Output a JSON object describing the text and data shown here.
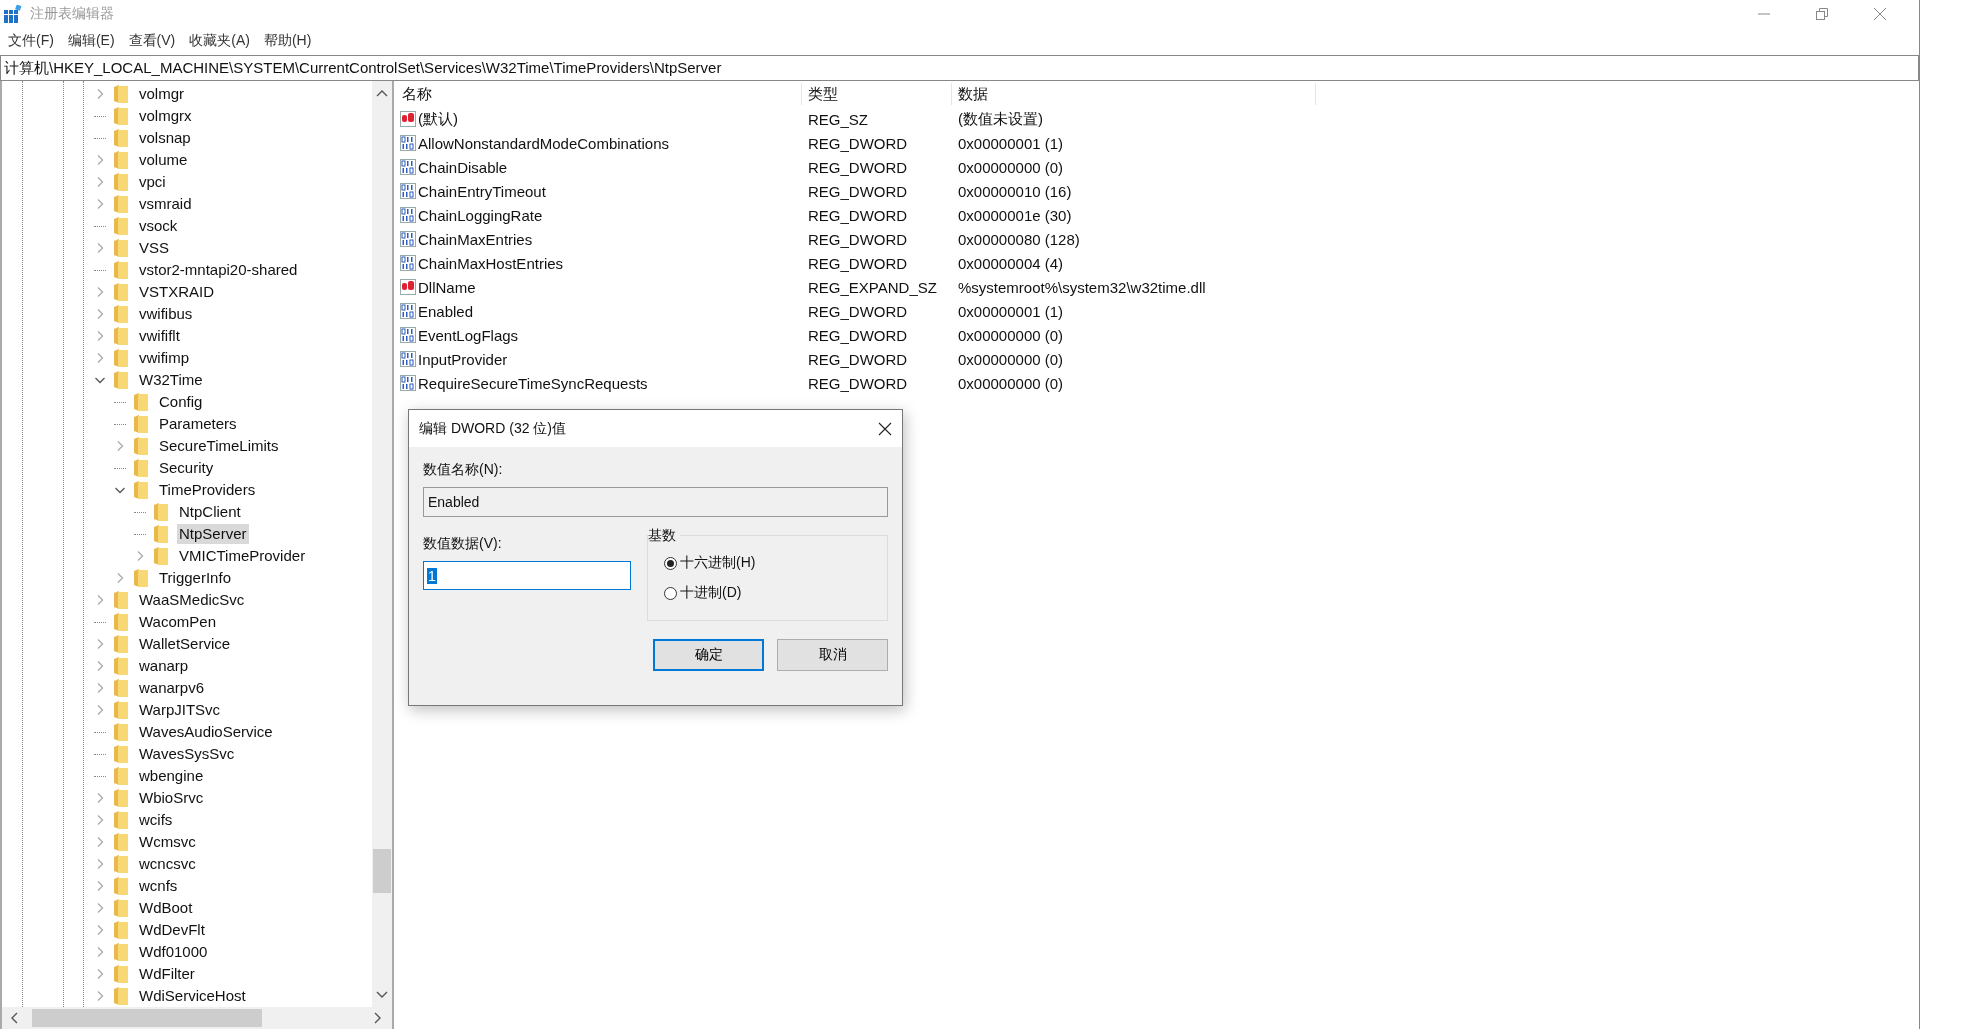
{
  "window": {
    "title": "注册表编辑器"
  },
  "menu": [
    "文件(F)",
    "编辑(E)",
    "查看(V)",
    "收藏夹(A)",
    "帮助(H)"
  ],
  "address_bar": {
    "value": "计算机\\HKEY_LOCAL_MACHINE\\SYSTEM\\CurrentControlSet\\Services\\W32Time\\TimeProviders\\NtpServer"
  },
  "tree": {
    "items": [
      {
        "label": "volmgr",
        "has_subkeys": true,
        "expanded": false,
        "selected": false
      },
      {
        "label": "volmgrx",
        "has_subkeys": false,
        "expanded": false,
        "selected": false
      },
      {
        "label": "volsnap",
        "has_subkeys": false,
        "expanded": false,
        "selected": false
      },
      {
        "label": "volume",
        "has_subkeys": true,
        "expanded": false,
        "selected": false
      },
      {
        "label": "vpci",
        "has_subkeys": true,
        "expanded": false,
        "selected": false
      },
      {
        "label": "vsmraid",
        "has_subkeys": true,
        "expanded": false,
        "selected": false
      },
      {
        "label": "vsock",
        "has_subkeys": false,
        "expanded": false,
        "selected": false
      },
      {
        "label": "VSS",
        "has_subkeys": true,
        "expanded": false,
        "selected": false
      },
      {
        "label": "vstor2-mntapi20-shared",
        "has_subkeys": false,
        "expanded": false,
        "selected": false
      },
      {
        "label": "VSTXRAID",
        "has_subkeys": true,
        "expanded": false,
        "selected": false
      },
      {
        "label": "vwifibus",
        "has_subkeys": true,
        "expanded": false,
        "selected": false
      },
      {
        "label": "vwififlt",
        "has_subkeys": true,
        "expanded": false,
        "selected": false
      },
      {
        "label": "vwifimp",
        "has_subkeys": true,
        "expanded": false,
        "selected": false
      },
      {
        "label": "W32Time",
        "has_subkeys": true,
        "expanded": true,
        "selected": false,
        "children": [
          {
            "label": "Config",
            "has_subkeys": false,
            "expanded": false,
            "selected": false
          },
          {
            "label": "Parameters",
            "has_subkeys": false,
            "expanded": false,
            "selected": false
          },
          {
            "label": "SecureTimeLimits",
            "has_subkeys": true,
            "expanded": false,
            "selected": false
          },
          {
            "label": "Security",
            "has_subkeys": false,
            "expanded": false,
            "selected": false
          },
          {
            "label": "TimeProviders",
            "has_subkeys": true,
            "expanded": true,
            "selected": false,
            "children": [
              {
                "label": "NtpClient",
                "has_subkeys": false,
                "expanded": false,
                "selected": false
              },
              {
                "label": "NtpServer",
                "has_subkeys": false,
                "expanded": false,
                "selected": true
              },
              {
                "label": "VMICTimeProvider",
                "has_subkeys": true,
                "expanded": false,
                "selected": false
              }
            ]
          },
          {
            "label": "TriggerInfo",
            "has_subkeys": true,
            "expanded": false,
            "selected": false
          }
        ]
      },
      {
        "label": "WaaSMedicSvc",
        "has_subkeys": true,
        "expanded": false,
        "selected": false
      },
      {
        "label": "WacomPen",
        "has_subkeys": false,
        "expanded": false,
        "selected": false
      },
      {
        "label": "WalletService",
        "has_subkeys": true,
        "expanded": false,
        "selected": false
      },
      {
        "label": "wanarp",
        "has_subkeys": true,
        "expanded": false,
        "selected": false
      },
      {
        "label": "wanarpv6",
        "has_subkeys": true,
        "expanded": false,
        "selected": false
      },
      {
        "label": "WarpJITSvc",
        "has_subkeys": true,
        "expanded": false,
        "selected": false
      },
      {
        "label": "WavesAudioService",
        "has_subkeys": false,
        "expanded": false,
        "selected": false
      },
      {
        "label": "WavesSysSvc",
        "has_subkeys": false,
        "expanded": false,
        "selected": false
      },
      {
        "label": "wbengine",
        "has_subkeys": false,
        "expanded": false,
        "selected": false
      },
      {
        "label": "WbioSrvc",
        "has_subkeys": true,
        "expanded": false,
        "selected": false
      },
      {
        "label": "wcifs",
        "has_subkeys": true,
        "expanded": false,
        "selected": false
      },
      {
        "label": "Wcmsvc",
        "has_subkeys": true,
        "expanded": false,
        "selected": false
      },
      {
        "label": "wcncsvc",
        "has_subkeys": true,
        "expanded": false,
        "selected": false
      },
      {
        "label": "wcnfs",
        "has_subkeys": true,
        "expanded": false,
        "selected": false
      },
      {
        "label": "WdBoot",
        "has_subkeys": true,
        "expanded": false,
        "selected": false
      },
      {
        "label": "WdDevFlt",
        "has_subkeys": true,
        "expanded": false,
        "selected": false
      },
      {
        "label": "Wdf01000",
        "has_subkeys": true,
        "expanded": false,
        "selected": false
      },
      {
        "label": "WdFilter",
        "has_subkeys": true,
        "expanded": false,
        "selected": false
      },
      {
        "label": "WdiServiceHost",
        "has_subkeys": true,
        "expanded": false,
        "selected": false
      }
    ]
  },
  "values_table": {
    "columns": [
      "名称",
      "类型",
      "数据"
    ],
    "rows": [
      {
        "kind": "string",
        "name": "(默认)",
        "type": "REG_SZ",
        "data": "(数值未设置)"
      },
      {
        "kind": "binary",
        "name": "AllowNonstandardModeCombinations",
        "type": "REG_DWORD",
        "data": "0x00000001 (1)"
      },
      {
        "kind": "binary",
        "name": "ChainDisable",
        "type": "REG_DWORD",
        "data": "0x00000000 (0)"
      },
      {
        "kind": "binary",
        "name": "ChainEntryTimeout",
        "type": "REG_DWORD",
        "data": "0x00000010 (16)"
      },
      {
        "kind": "binary",
        "name": "ChainLoggingRate",
        "type": "REG_DWORD",
        "data": "0x0000001e (30)"
      },
      {
        "kind": "binary",
        "name": "ChainMaxEntries",
        "type": "REG_DWORD",
        "data": "0x00000080 (128)"
      },
      {
        "kind": "binary",
        "name": "ChainMaxHostEntries",
        "type": "REG_DWORD",
        "data": "0x00000004 (4)"
      },
      {
        "kind": "string",
        "name": "DllName",
        "type": "REG_EXPAND_SZ",
        "data": "%systemroot%\\system32\\w32time.dll"
      },
      {
        "kind": "binary",
        "name": "Enabled",
        "type": "REG_DWORD",
        "data": "0x00000001 (1)"
      },
      {
        "kind": "binary",
        "name": "EventLogFlags",
        "type": "REG_DWORD",
        "data": "0x00000000 (0)"
      },
      {
        "kind": "binary",
        "name": "InputProvider",
        "type": "REG_DWORD",
        "data": "0x00000000 (0)"
      },
      {
        "kind": "binary",
        "name": "RequireSecureTimeSyncRequests",
        "type": "REG_DWORD",
        "data": "0x00000000 (0)"
      }
    ]
  },
  "dialog": {
    "title": "编辑 DWORD (32 位)值",
    "name_label": "数值名称(N):",
    "name_value": "Enabled",
    "data_label": "数值数据(V):",
    "data_value": "1",
    "base_label": "基数",
    "bases": [
      {
        "label": "十六进制(H)",
        "selected": true
      },
      {
        "label": "十进制(D)",
        "selected": false
      }
    ],
    "buttons": [
      {
        "label": "确定",
        "default": true
      },
      {
        "label": "取消",
        "default": false
      }
    ]
  }
}
